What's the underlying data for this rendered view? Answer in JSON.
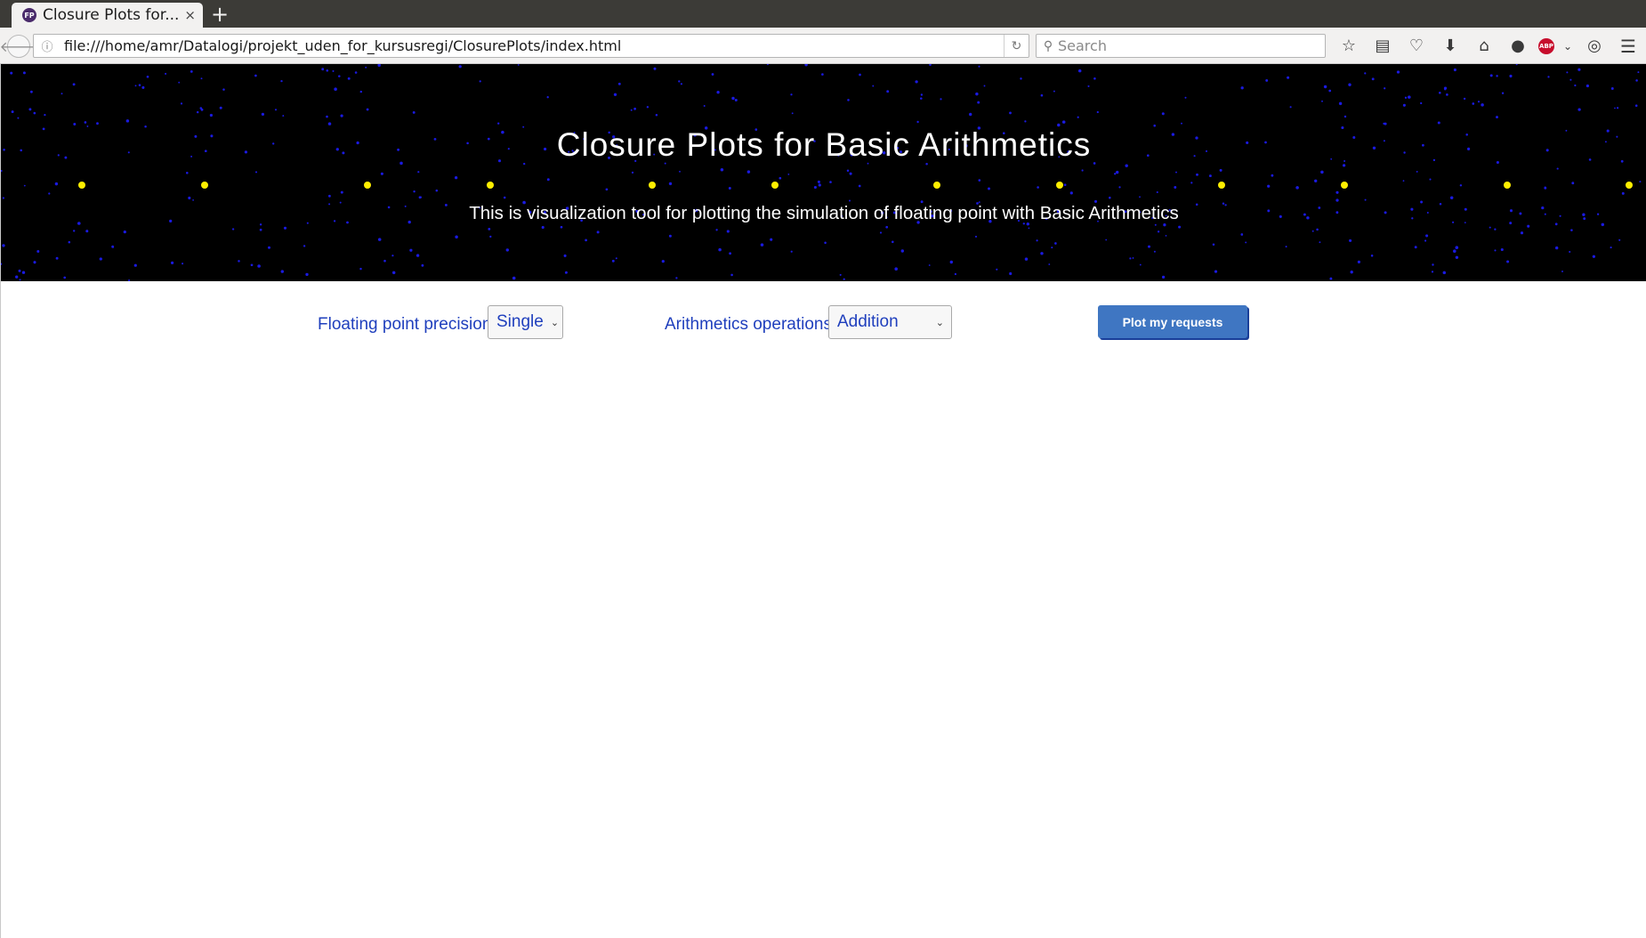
{
  "browser": {
    "tab_title": "Closure Plots for...",
    "favicon_text": "FP",
    "tab_close": "×",
    "new_tab": "+",
    "url": "file:///home/amr/Datalogi/projekt_uden_for_kursusregi/ClosurePlots/index.html",
    "search_placeholder": "Search",
    "abp_label": "ABP",
    "toolbar_icons": [
      "star-icon",
      "reader-list-icon",
      "pocket-icon",
      "download-icon",
      "home-icon",
      "chat-icon",
      "abp-icon",
      "chevron-down-icon",
      "sync-icon",
      "menu-icon"
    ]
  },
  "hero": {
    "title": "Closure Plots for Basic Arithmetics",
    "subtitle": "This is visualization tool for plotting the simulation of floating point with Basic Arithmetics",
    "background_color": "#000000",
    "star_color": "#1a1ae0",
    "highlight_color": "#ffee00"
  },
  "controls": {
    "precision_label": "Floating point precision",
    "precision_value": "Single",
    "operation_label": "Arithmetics operations",
    "operation_value": "Addition",
    "plot_button": "Plot my requests",
    "accent_color": "#1f3fbd",
    "button_color": "#3f76c2"
  }
}
